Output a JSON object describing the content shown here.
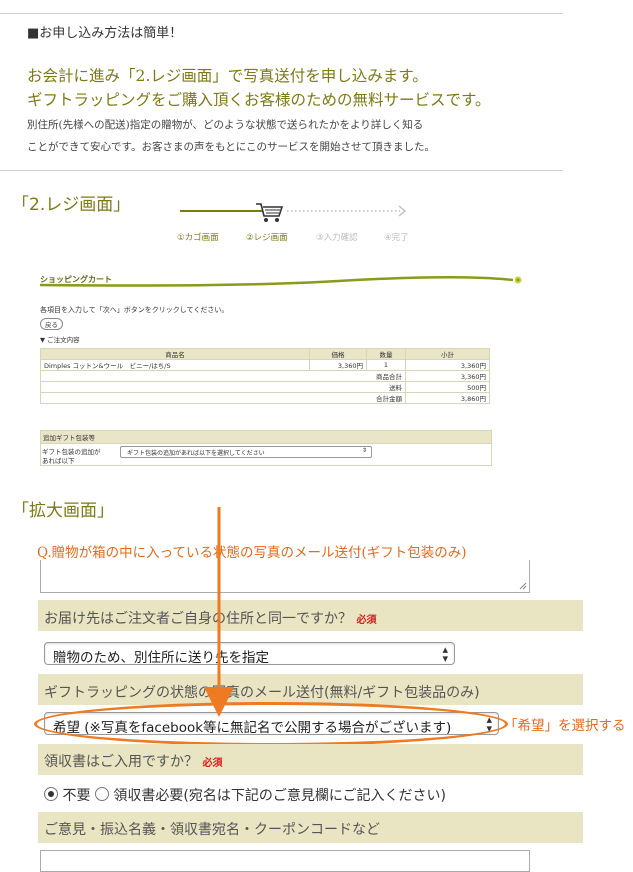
{
  "intro": {
    "heading": "■お申し込み方法は簡単！",
    "lead1": "お会計に進み「2.レジ画面」で写真送付を申し込みます。",
    "lead2": "ギフトラッピングをご購入頂くお客様のための無料サービスです。",
    "body1": "別住所(先様への配送)指定の贈物が、どのような状態で送られたかをより詳しく知る",
    "body2": "ことができて安心です。お客さまの声をもとにこのサービスを開始させて頂きました。"
  },
  "reji_section": {
    "title": "「2.レジ画面」",
    "steps": [
      "①カゴ画面",
      "②レジ画面",
      "③入力確認",
      "④完了"
    ],
    "active_step": 2,
    "cart_title": "ショッピングカート",
    "instruction": "各項目を入力して「次へ」ボタンをクリックしてください。",
    "back_button": "戻る",
    "order_heading": "▼ ご注文内容",
    "table_headers": [
      "商品名",
      "価格",
      "数量",
      "小計"
    ],
    "rows": [
      {
        "name": "Dimples コットン&ウール　ビニー/はち/S",
        "price": "3,360円",
        "qty": "1",
        "subtotal": "3,360円"
      }
    ],
    "totals": [
      {
        "label": "商品合計",
        "value": "3,360円"
      },
      {
        "label": "送料",
        "value": "500円"
      },
      {
        "label": "合計金額",
        "value": "3,860円"
      }
    ],
    "gift_heading": "追加ギフト包装等",
    "gift_label1": "ギフト包装の追加が",
    "gift_label2": "あれば以下",
    "gift_select": "ギフト包装の追加があれば以下を選択してください"
  },
  "zoom_section": {
    "title": "「拡大画面」",
    "question": "Q.贈物が箱の中に入っている状態の写真のメール送付(ギフト包装のみ)",
    "same_address_label": "お届け先はご注文者ご自身の住所と同一ですか？",
    "required": "必須",
    "address_select": "贈物のため、別住所に送り先を指定",
    "photo_label": "ギフトラッピングの状態の写真のメール送付(無料/ギフト包装品のみ)",
    "photo_select": "希望 (※写真をfacebook等に無記名で公開する場合がございます)",
    "callout": "「希望」を選択する",
    "receipt_label": "領収書はご入用ですか？",
    "receipt_options": [
      "不要",
      "領収書必要(宛名は下記のご意見欄にご記入ください)"
    ],
    "receipt_selected": "不要",
    "comment_label": "ご意見・振込名義・領収書宛名・クーポンコードなど"
  },
  "colors": {
    "olive": "#7d7a14",
    "orange": "#e76a1a",
    "band": "#e9e4c1",
    "cart_green": "#8a9a1a"
  }
}
